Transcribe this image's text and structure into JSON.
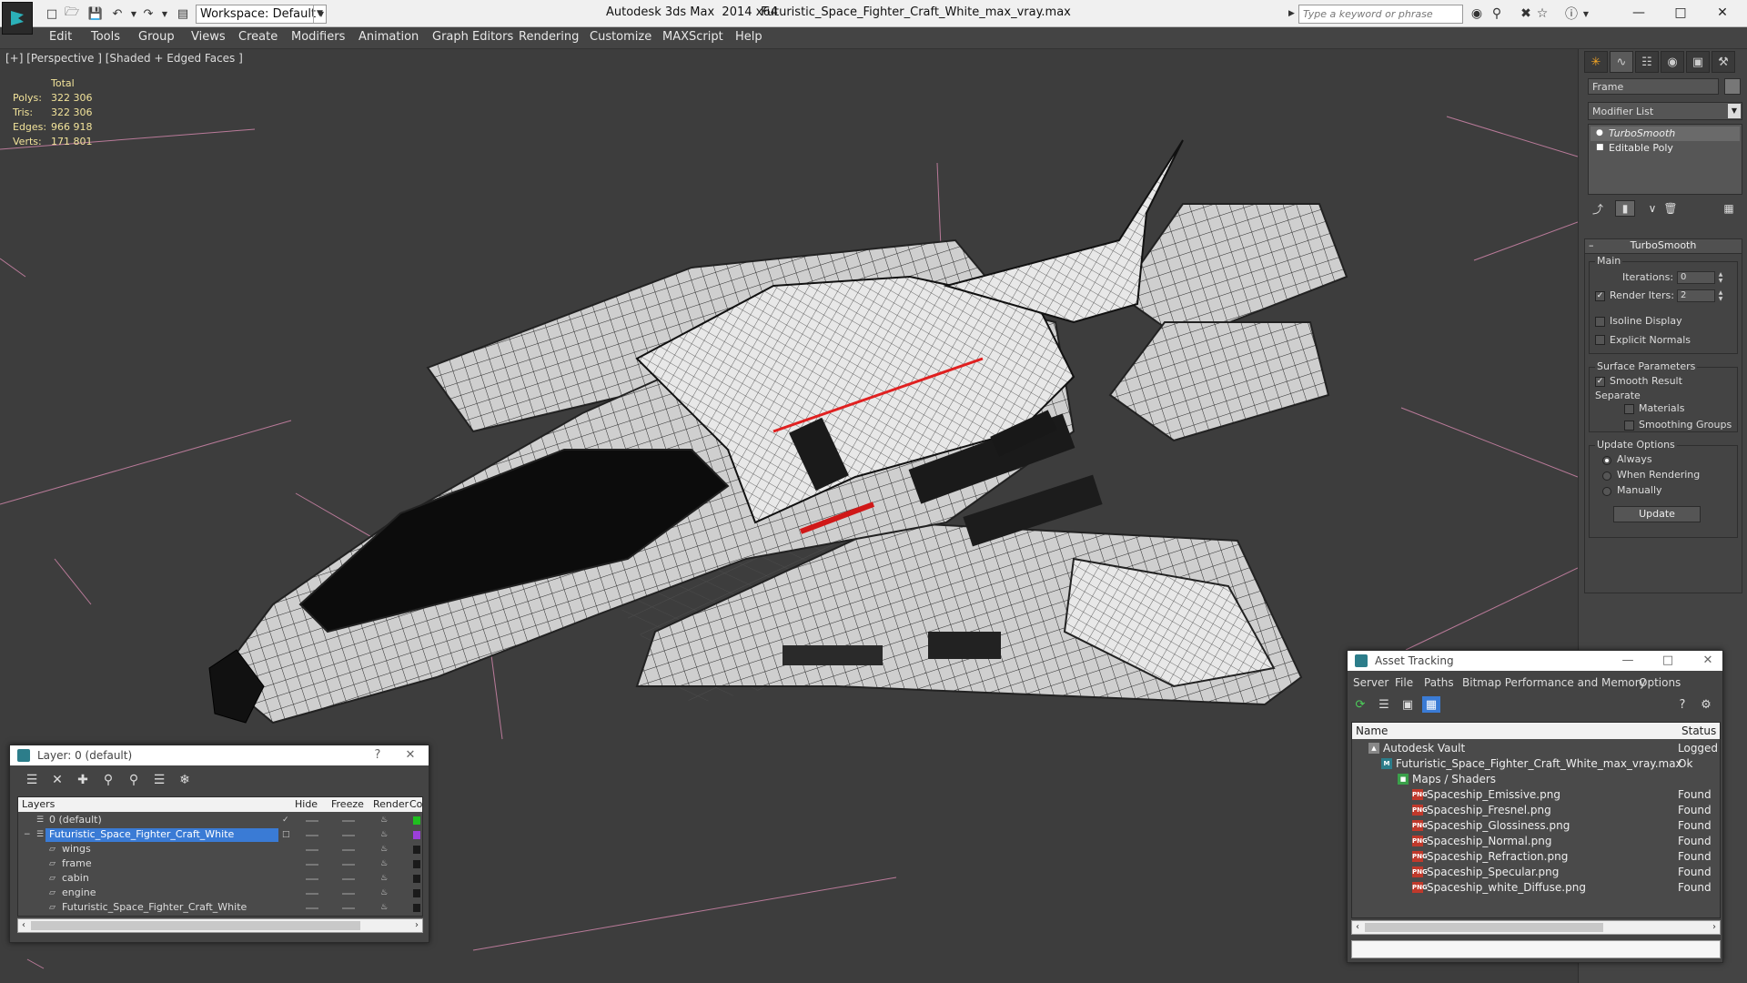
{
  "titlebar": {
    "app_title": "Autodesk 3ds Max  2014 x64",
    "file_title": "Futuristic_Space_Fighter_Craft_White_max_vray.max",
    "workspace": "Workspace: Default",
    "search_placeholder": "Type a keyword or phrase"
  },
  "menu": [
    "Edit",
    "Tools",
    "Group",
    "Views",
    "Create",
    "Modifiers",
    "Animation",
    "Graph Editors",
    "Rendering",
    "Customize",
    "MAXScript",
    "Help"
  ],
  "viewport": {
    "label": "[+] [Perspective ] [Shaded + Edged Faces ]",
    "stats_header": "Total",
    "stats": [
      {
        "label": "Polys:",
        "value": "322 306"
      },
      {
        "label": "Tris:",
        "value": "322 306"
      },
      {
        "label": "Edges:",
        "value": "966 918"
      },
      {
        "label": "Verts:",
        "value": "171 801"
      }
    ]
  },
  "command_panel": {
    "object_name": "Frame",
    "modifier_list": "Modifier List",
    "stack": [
      "TurboSmooth",
      "Editable Poly"
    ],
    "rollout_title": "TurboSmooth",
    "main_group": "Main",
    "iterations_label": "Iterations:",
    "iterations_value": "0",
    "render_iters_label": "Render Iters:",
    "render_iters_value": "2",
    "isoline_label": "Isoline Display",
    "explicit_normals_label": "Explicit Normals",
    "surface_group": "Surface Parameters",
    "smooth_result_label": "Smooth Result",
    "separate_label": "Separate",
    "materials_label": "Materials",
    "smoothing_groups_label": "Smoothing Groups",
    "update_group": "Update Options",
    "always_label": "Always",
    "when_rendering_label": "When Rendering",
    "manually_label": "Manually",
    "update_button": "Update"
  },
  "layer_window": {
    "title": "Layer: 0 (default)",
    "help": "?",
    "columns": [
      "Layers",
      "Hide",
      "Freeze",
      "Render",
      "Col"
    ],
    "rows": [
      {
        "name": "0 (default)",
        "color": "#1fbf1f"
      },
      {
        "name": "Futuristic_Space_Fighter_Craft_White",
        "color": "#9b3fd9"
      },
      {
        "name": "wings",
        "color": "#1a1a1a"
      },
      {
        "name": "frame",
        "color": "#1a1a1a"
      },
      {
        "name": "cabin",
        "color": "#1a1a1a"
      },
      {
        "name": "engine",
        "color": "#1a1a1a"
      },
      {
        "name": "Futuristic_Space_Fighter_Craft_White",
        "color": "#1a1a1a"
      }
    ]
  },
  "asset_window": {
    "title": "Asset Tracking",
    "menu": [
      "Server",
      "File",
      "Paths",
      "Bitmap Performance and Memory",
      "Options"
    ],
    "columns": [
      "Name",
      "Status"
    ],
    "rows": [
      {
        "name": "Autodesk Vault",
        "status": "Logged O"
      },
      {
        "name": "Futuristic_Space_Fighter_Craft_White_max_vray.max",
        "status": "Ok"
      },
      {
        "name": "Maps / Shaders",
        "status": ""
      },
      {
        "name": "Spaceship_Emissive.png",
        "status": "Found"
      },
      {
        "name": "Spaceship_Fresnel.png",
        "status": "Found"
      },
      {
        "name": "Spaceship_Glossiness.png",
        "status": "Found"
      },
      {
        "name": "Spaceship_Normal.png",
        "status": "Found"
      },
      {
        "name": "Spaceship_Refraction.png",
        "status": "Found"
      },
      {
        "name": "Spaceship_Specular.png",
        "status": "Found"
      },
      {
        "name": "Spaceship_white_Diffuse.png",
        "status": "Found"
      }
    ],
    "png_badge": "PNG"
  },
  "colors": {
    "stats_text": "#f2e39a",
    "selection": "#3a7bd5",
    "ui_dark": "#444444"
  }
}
